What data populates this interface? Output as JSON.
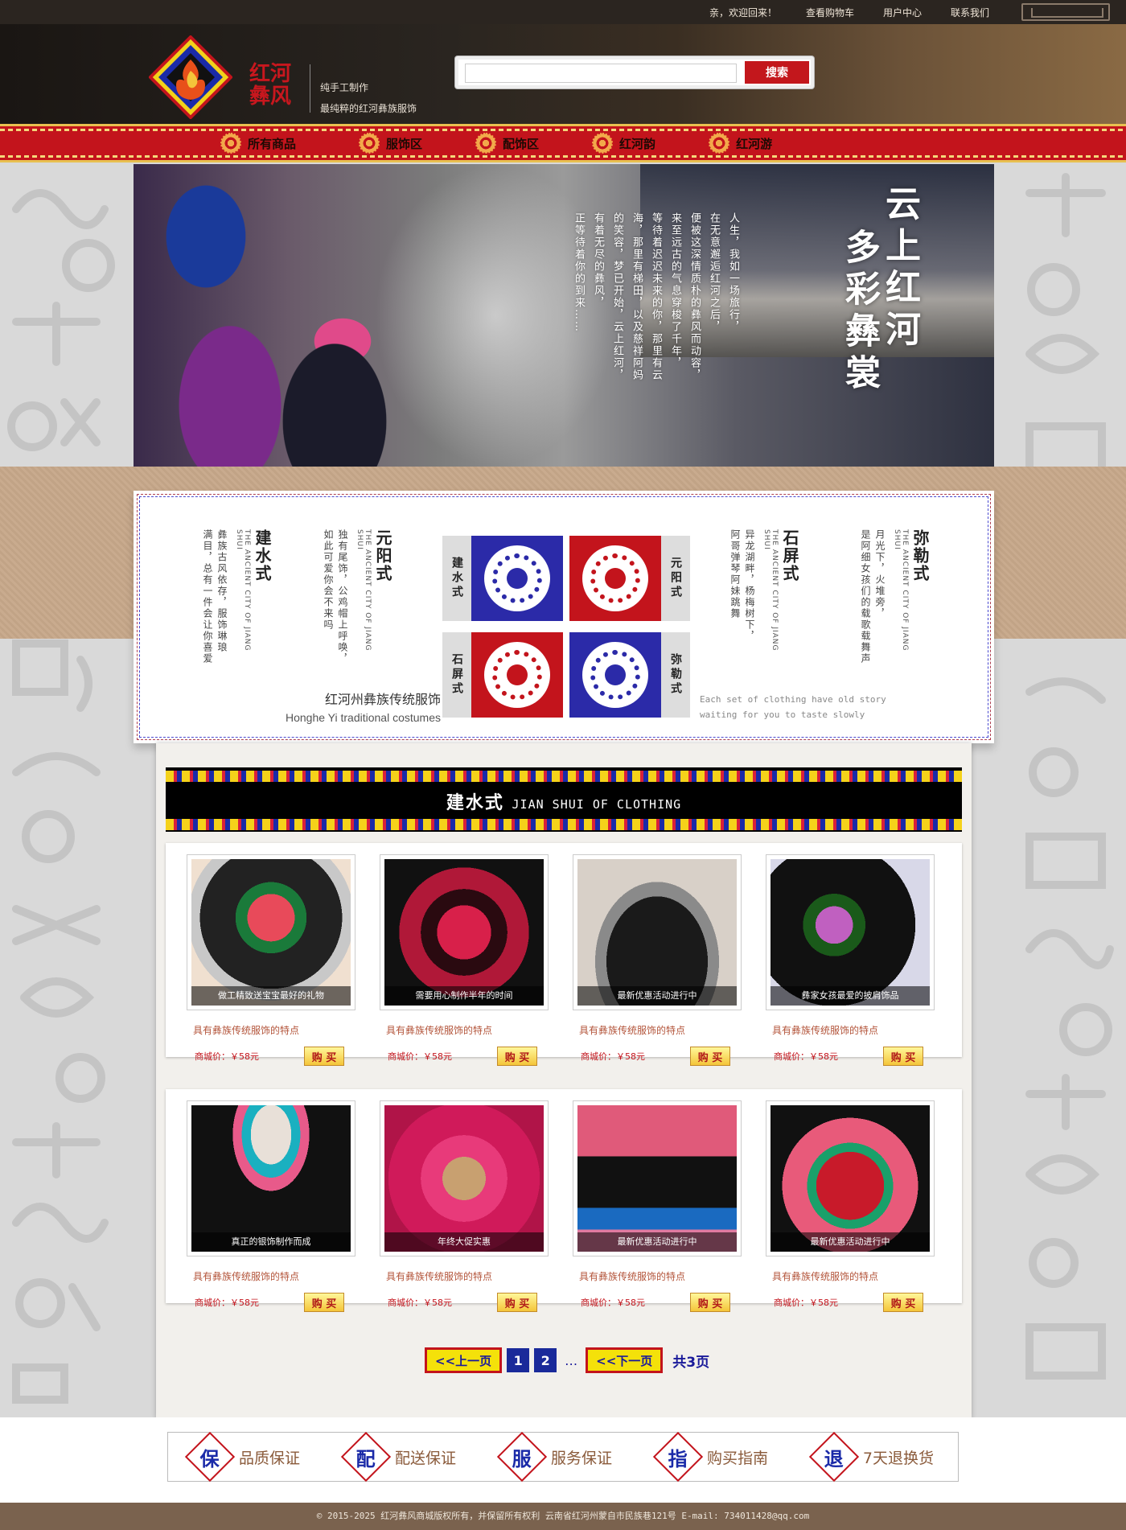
{
  "topbar": {
    "welcome": "亲，欢迎回来！",
    "cart": "查看购物车",
    "user_center": "用户中心",
    "contact": "联系我们"
  },
  "header": {
    "logo_line1": "红河",
    "logo_line2": "彝风",
    "slogan_line1": "纯手工制作",
    "slogan_line2": "最纯粹的红河彝族服饰",
    "search_placeholder": "",
    "search_button": "搜索"
  },
  "nav": {
    "items": [
      "所有商品",
      "服饰区",
      "配饰区",
      "红河韵",
      "红河游"
    ]
  },
  "banner": {
    "title_line1": "云上红河",
    "title_line2": "多彩彝裳",
    "poem": [
      "人生，我如一场旅行，",
      "在无意邂逅红河之后，",
      "便被这深情质朴的彝风而动容，",
      "来至远古的气息穿梭了千年，",
      "等待着迟迟未来的你，那里有云",
      "海，那里有梯田，以及慈祥阿妈",
      "的笑容，梦已开始，云上红河，",
      "有着无尽的彝风，",
      "正等待着你的到来……"
    ]
  },
  "styles": {
    "items": [
      {
        "name": "建水式",
        "sub": "THE ANCIENT CITY OF JIANG SHUI",
        "desc": [
          "彝族古风依存，服饰琳琅",
          "满目，总有一件会让你喜爱"
        ]
      },
      {
        "name": "元阳式",
        "sub": "THE ANCIENT CITY OF JIANG SHUI",
        "desc": [
          "独有尾饰，公鸡帽上呼唤，",
          "如此可爱你会不来吗"
        ]
      },
      {
        "name": "石屏式",
        "sub": "THE ANCIENT CITY OF JIANG SHUI",
        "desc": [
          "异龙湖畔，杨梅树下，",
          "阿哥弹琴阿妹跳舞"
        ]
      },
      {
        "name": "弥勒式",
        "sub": "THE ANCIENT CITY OF JIANG SHUI",
        "desc": [
          "月光下，火堆旁，",
          "是阿细女孩们的载歌载舞声"
        ]
      }
    ],
    "tiles": [
      {
        "label": "建水式",
        "color": "#2b2aa8"
      },
      {
        "label": "元阳式",
        "color": "#c3141c"
      },
      {
        "label": "石屏式",
        "color": "#c3141c"
      },
      {
        "label": "弥勒式",
        "color": "#2b2aa8"
      }
    ],
    "caption_zh": "红河州彝族传统服饰",
    "caption_en": "Honghe Yi traditional costumes",
    "note_line1": "Each set of clothing have old story",
    "note_line2": "waiting for you to taste slowly"
  },
  "category": {
    "title": "建水式",
    "title_en": "JIAN SHUI OF CLOTHING"
  },
  "products": [
    {
      "caption": "做工精致送宝宝最好的礼物",
      "title": "具有彝族传统服饰的特点",
      "price": "商城价：￥58元",
      "buy": "购 买"
    },
    {
      "caption": "需要用心制作半年的时间",
      "title": "具有彝族传统服饰的特点",
      "price": "商城价：￥58元",
      "buy": "购 买"
    },
    {
      "caption": "最新优惠活动进行中",
      "title": "具有彝族传统服饰的特点",
      "price": "商城价：￥58元",
      "buy": "购 买"
    },
    {
      "caption": "彝家女孩最爱的披肩饰品",
      "title": "具有彝族传统服饰的特点",
      "price": "商城价：￥58元",
      "buy": "购 买"
    },
    {
      "caption": "真正的银饰制作而成",
      "title": "具有彝族传统服饰的特点",
      "price": "商城价：￥58元",
      "buy": "购 买"
    },
    {
      "caption": "年终大促实惠",
      "title": "具有彝族传统服饰的特点",
      "price": "商城价：￥58元",
      "buy": "购 买"
    },
    {
      "caption": "最新优惠活动进行中",
      "title": "具有彝族传统服饰的特点",
      "price": "商城价：￥58元",
      "buy": "购 买"
    },
    {
      "caption": "最新优惠活动进行中",
      "title": "具有彝族传统服饰的特点",
      "price": "商城价：￥58元",
      "buy": "购 买"
    }
  ],
  "pager": {
    "prev": "<<上一页",
    "pages": [
      "1",
      "2"
    ],
    "ellipsis": "…",
    "next": "<<下一页",
    "total": "共3页"
  },
  "guarantees": [
    {
      "icon": "保",
      "label": "品质保证"
    },
    {
      "icon": "配",
      "label": "配送保证"
    },
    {
      "icon": "服",
      "label": "服务保证"
    },
    {
      "icon": "指",
      "label": "购买指南"
    },
    {
      "icon": "退",
      "label": "7天退换货"
    }
  ],
  "footer": {
    "copyright": "© 2015-2025 红河彝风商城版权所有，并保留所有权利     云南省红河州蒙自市民族巷121号 E-mail: 734011428@qq.com"
  },
  "colors": {
    "brand_red": "#c3141c",
    "nav_gold": "#e8c050",
    "tan": "#c7a88a"
  }
}
